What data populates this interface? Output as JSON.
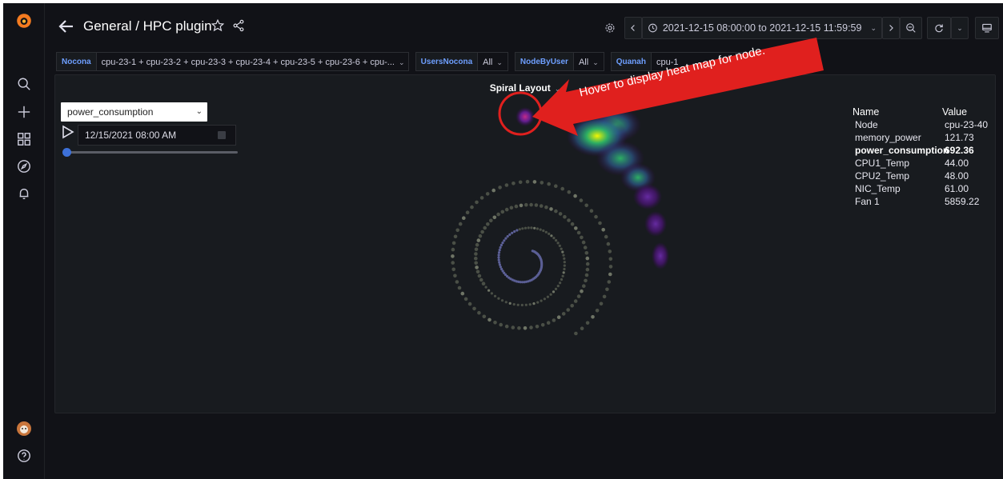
{
  "nav": {
    "breadcrumb": "General / HPC plugin",
    "time_range": "2021-12-15 08:00:00 to 2021-12-15 11:59:59"
  },
  "variables": [
    {
      "label": "Nocona",
      "value": "cpu-23-1 + cpu-23-2 + cpu-23-3 + cpu-23-4 + cpu-23-5 + cpu-23-6 + cpu-..."
    },
    {
      "label": "UsersNocona",
      "value": "All"
    },
    {
      "label": "NodeByUser",
      "value": "All"
    },
    {
      "label": "Quanah",
      "value": "cpu-1"
    }
  ],
  "panel": {
    "title": "Spiral Layout",
    "metric_select": "power_consumption",
    "date_input": "12/15/2021 08:00 AM",
    "slider_value": 0
  },
  "info_table": {
    "header": {
      "name": "Name",
      "value": "Value"
    },
    "rows": [
      {
        "name": "Node",
        "value": "cpu-23-40"
      },
      {
        "name": "memory_power",
        "value": "121.73"
      },
      {
        "name": "power_consumption",
        "value": "692.36"
      },
      {
        "name": "CPU1_Temp",
        "value": "44.00"
      },
      {
        "name": "CPU2_Temp",
        "value": "48.00"
      },
      {
        "name": "NIC_Temp",
        "value": "61.00"
      },
      {
        "name": "Fan 1",
        "value": "5859.22"
      }
    ]
  },
  "annotation": {
    "text": "Hover to display heat map for node."
  },
  "colors": {
    "background": "#111217",
    "panel": "#181b1f",
    "accent_blue": "#3d71d9",
    "variable_label": "#6e9fff",
    "annotation_red": "#e0201e",
    "logo_orange": "#f47b20"
  },
  "icons": {
    "sidebar": [
      "grafana-logo-icon",
      "search-icon",
      "plus-icon",
      "dashboards-icon",
      "explore-icon",
      "alerting-icon",
      "user-avatar",
      "help-icon"
    ],
    "toolbar": [
      "back-arrow-icon",
      "star-icon",
      "share-icon",
      "settings-icon",
      "chevron-left-icon",
      "clock-icon",
      "chevron-right-icon",
      "zoom-out-icon",
      "refresh-icon",
      "tv-mode-icon"
    ]
  }
}
